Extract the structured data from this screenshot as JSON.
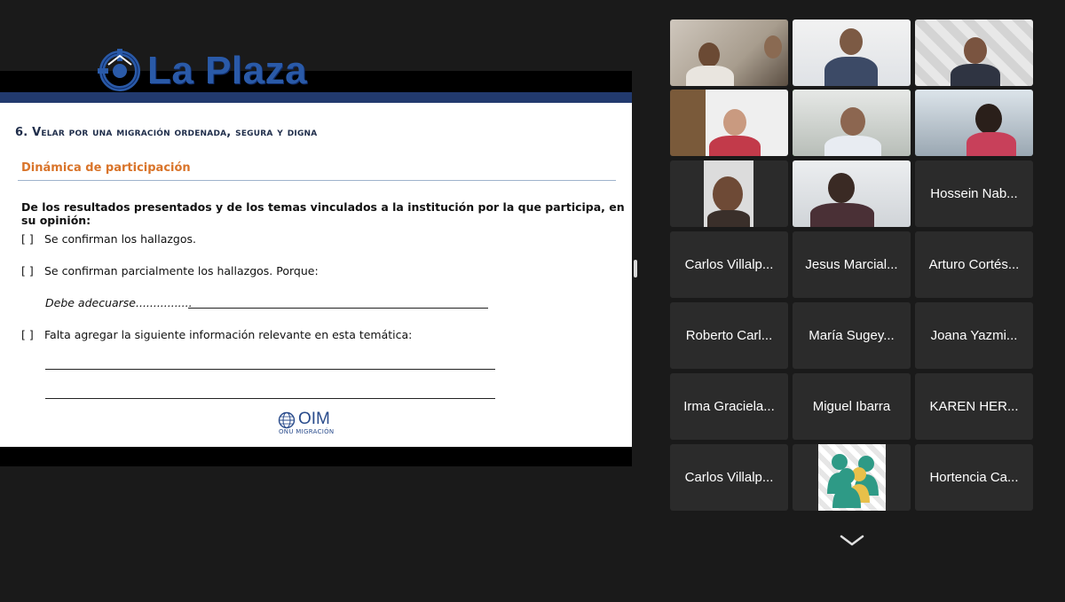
{
  "app": {
    "logo_text": "La Plaza"
  },
  "slide": {
    "title": "6. Velar por una migración ordenada, segura y digna",
    "section_heading": "Dinámica de participación",
    "question": "De los resultados presentados y de los temas vinculados a la institución por la que participa, en su opinión:",
    "options": [
      {
        "box": "[ ]",
        "text": "Se confirman los hallazgos."
      },
      {
        "box": "[ ]",
        "text": "Se confirman parcialmente los hallazgos.  Porque:"
      },
      {
        "box": "[ ]",
        "text": "Falta agregar la siguiente información relevante en esta temática:"
      }
    ],
    "answer_text": "Debe adecuarse................",
    "org_logo": {
      "word": "OIM",
      "subtitle": "ONU MIGRACIÓN"
    }
  },
  "gallery": {
    "participants": [
      "Hossein Nab...",
      "Carlos Villalp...",
      "Jesus Marcial...",
      "Arturo Cortés...",
      "Roberto Carl...",
      "María Sugey...",
      "Joana Yazmi...",
      "Irma Graciela...",
      "Miguel Ibarra",
      "KAREN HER...",
      "Carlos Villalp...",
      "Hortencia Ca..."
    ]
  },
  "colors": {
    "slide_band": "#223a6e",
    "logo_blue": "#2a5aa8",
    "section_orange": "#d9742a",
    "active_speaker": "#4bd34b",
    "tile_bg": "#2b2b2b"
  },
  "icons": [
    "la-plaza-logo-icon",
    "oim-globe-icon",
    "group-avatar-icon",
    "chevron-down-icon"
  ]
}
